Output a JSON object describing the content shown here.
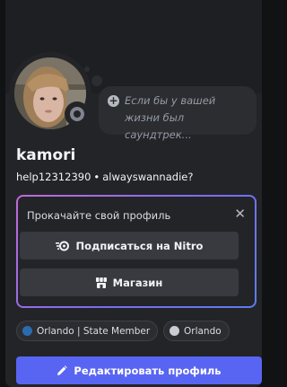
{
  "profile": {
    "username": "kamori",
    "handle": "help12312390",
    "separator": "•",
    "pronouns": "alwayswannadie?",
    "status": "idle-offline"
  },
  "custom_status": {
    "placeholder": "Если бы у вашей жизни был саундтрек..."
  },
  "nitro_card": {
    "title": "Прокачайте свой профиль",
    "subscribe_label": "Подписаться на Nitro",
    "shop_label": "Магазин"
  },
  "roles": [
    {
      "label": "Orlando | State Member",
      "color": "#2b6cb0"
    },
    {
      "label": "Orlando",
      "color": "#c9cdd3"
    }
  ],
  "actions": {
    "edit_profile_label": "Редактировать профиль"
  },
  "colors": {
    "accent": "#5865f2",
    "background": "#232428",
    "gradient_start": "#c06bd6",
    "gradient_end": "#5b7df2"
  }
}
